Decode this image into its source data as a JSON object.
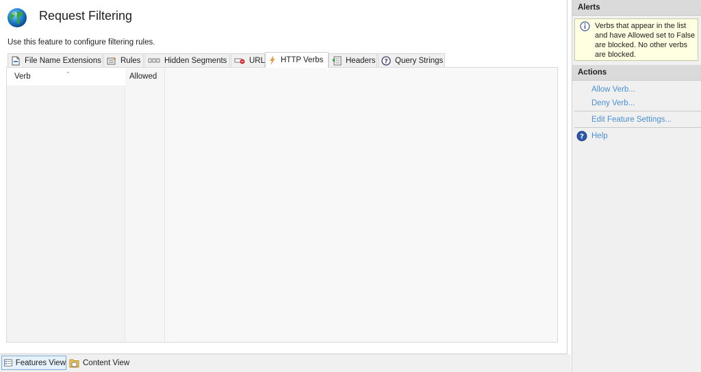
{
  "header": {
    "title": "Request Filtering",
    "description": "Use this feature to configure filtering rules.",
    "icon": "globe-icon"
  },
  "tabs": [
    {
      "label": "File Name Extensions",
      "icon": "file-extension-icon",
      "active": false
    },
    {
      "label": "Rules",
      "icon": "rules-icon",
      "active": false
    },
    {
      "label": "Hidden Segments",
      "icon": "hidden-segments-icon",
      "active": false
    },
    {
      "label": "URL",
      "icon": "url-icon",
      "active": false
    },
    {
      "label": "HTTP Verbs",
      "icon": "lightning-icon",
      "active": true
    },
    {
      "label": "Headers",
      "icon": "headers-icon",
      "active": false
    },
    {
      "label": "Query Strings",
      "icon": "query-strings-icon",
      "active": false
    }
  ],
  "grid": {
    "columns": [
      "Verb",
      "Allowed"
    ],
    "rows": []
  },
  "view_tabs": {
    "features": "Features View",
    "content": "Content View"
  },
  "alerts": {
    "heading": "Alerts",
    "message": "Verbs that appear in the list and have Allowed set to False are blocked. No other verbs are blocked."
  },
  "actions": {
    "heading": "Actions",
    "allow_verb": "Allow Verb...",
    "deny_verb": "Deny Verb...",
    "edit_settings": "Edit Feature Settings...",
    "help": "Help"
  },
  "colors": {
    "link": "#4a8fd6",
    "alert_bg": "#ffffe1",
    "section_bg": "#dadada"
  }
}
